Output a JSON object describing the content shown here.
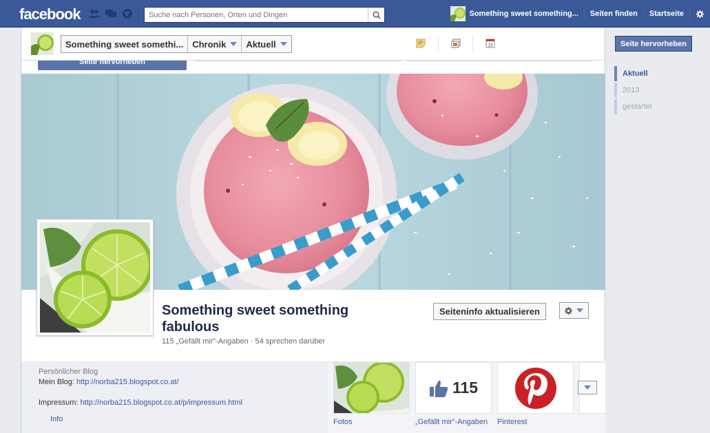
{
  "topbar": {
    "logo": "facebook",
    "search_placeholder": "Suche nach Personen, Orten und Dingen",
    "page_name": "Something sweet something...",
    "find_pages": "Seiten finden",
    "home": "Startseite"
  },
  "subnav": {
    "crumbs": [
      "Something sweet somethi...",
      "Chronik",
      "Aktuell"
    ]
  },
  "ghost_button": "Seite hervorheben",
  "page": {
    "name": "Something sweet something fabulous",
    "stats": "115 „Gefällt mir“-Angaben · 54 sprechen darüber",
    "update_button": "Seiteninfo aktualisieren"
  },
  "about": {
    "category": "Persönlicher Blog",
    "blog_label": "Mein Blog: ",
    "blog_url": "http://norba215.blogspot.co.at/",
    "impressum_label": "Impressum: ",
    "impressum_url": "http://norba215.blogspot.co.at/p/impressum.html",
    "info_link": "Info"
  },
  "apps": [
    {
      "label": "Fotos"
    },
    {
      "label": "„Gefällt mir“-Angaben",
      "count": "115"
    },
    {
      "label": "Pinterest"
    }
  ],
  "rail": {
    "promote_button": "Seite hervorheben",
    "timeline": [
      "Aktuell",
      "2013",
      "gestartet"
    ]
  },
  "colors": {
    "brand": "#3b5998",
    "pinterest": "#cb2027"
  }
}
